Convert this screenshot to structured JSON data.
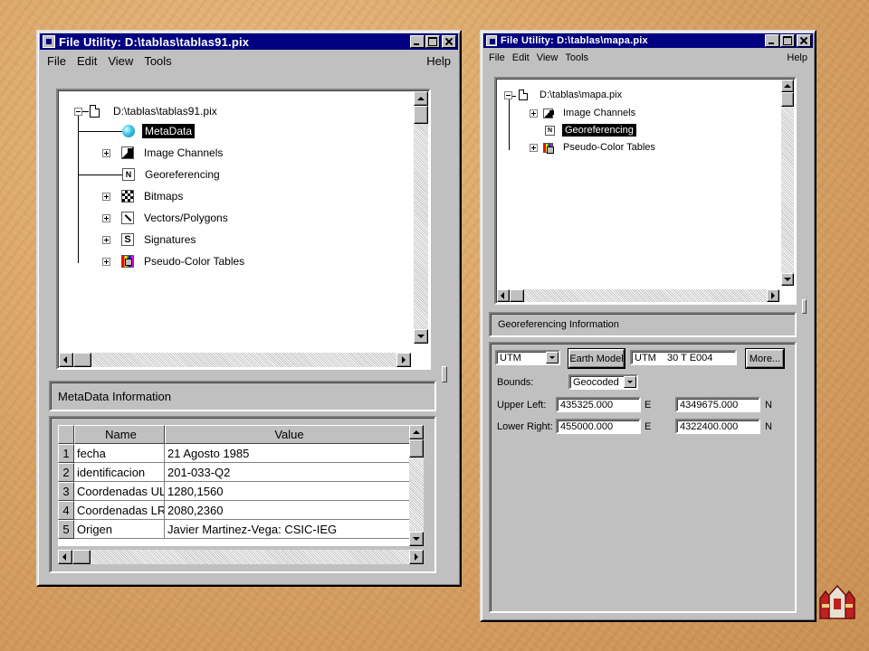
{
  "colors": {
    "titlebar": "#000080",
    "face": "#c0c0c0",
    "selection": "#000000",
    "background": "#d9a467"
  },
  "left_window": {
    "title": "File Utility: D:\\tablas\\tablas91.pix",
    "menu": {
      "file": "File",
      "edit": "Edit",
      "view": "View",
      "tools": "Tools",
      "help": "Help"
    },
    "tree": {
      "root": "D:\\tablas\\tablas91.pix",
      "items": [
        {
          "label": "MetaData",
          "icon": "globe-icon",
          "selected": true
        },
        {
          "label": "Image Channels",
          "icon": "channels-icon"
        },
        {
          "label": "Georeferencing",
          "icon": "georef-icon"
        },
        {
          "label": "Bitmaps",
          "icon": "bitmap-icon"
        },
        {
          "label": "Vectors/Polygons",
          "icon": "vector-icon"
        },
        {
          "label": "Signatures",
          "icon": "signature-icon"
        },
        {
          "label": "Pseudo-Color Tables",
          "icon": "pct-icon"
        }
      ]
    },
    "info_title": "MetaData Information",
    "table": {
      "headers": [
        "Name",
        "Value"
      ],
      "rows": [
        {
          "num": "1",
          "name": "fecha",
          "value": "21 Agosto 1985"
        },
        {
          "num": "2",
          "name": "identificacion",
          "value": "201-033-Q2"
        },
        {
          "num": "3",
          "name": "Coordenadas UL",
          "value": "1280,1560"
        },
        {
          "num": "4",
          "name": "Coordenadas LR",
          "value": "2080,2360"
        },
        {
          "num": "5",
          "name": "Origen",
          "value": "Javier Martinez-Vega: CSIC-IEG"
        }
      ]
    }
  },
  "right_window": {
    "title": "File Utility: D:\\tablas\\mapa.pix",
    "menu": {
      "file": "File",
      "edit": "Edit",
      "view": "View",
      "tools": "Tools",
      "help": "Help"
    },
    "tree": {
      "root": "D:\\tablas\\mapa.pix",
      "items": [
        {
          "label": "Image Channels",
          "icon": "channels-icon"
        },
        {
          "label": "Georeferencing",
          "icon": "georef-icon",
          "selected": true
        },
        {
          "label": "Pseudo-Color Tables",
          "icon": "pct-icon"
        }
      ]
    },
    "info_title": "Georeferencing Information",
    "georef": {
      "projection": "UTM",
      "earth_model_button": "Earth Model",
      "earth_model_value": "UTM    30 T E004",
      "more_button": "More...",
      "bounds_label": "Bounds:",
      "bounds_value": "Geocoded",
      "upper_left_label": "Upper Left:",
      "upper_left_e": "435325.000",
      "upper_left_n": "4349675.000",
      "lower_right_label": "Lower Right:",
      "lower_right_e": "455000.000",
      "lower_right_n": "4322400.000",
      "e_unit": "E",
      "n_unit": "N"
    }
  }
}
